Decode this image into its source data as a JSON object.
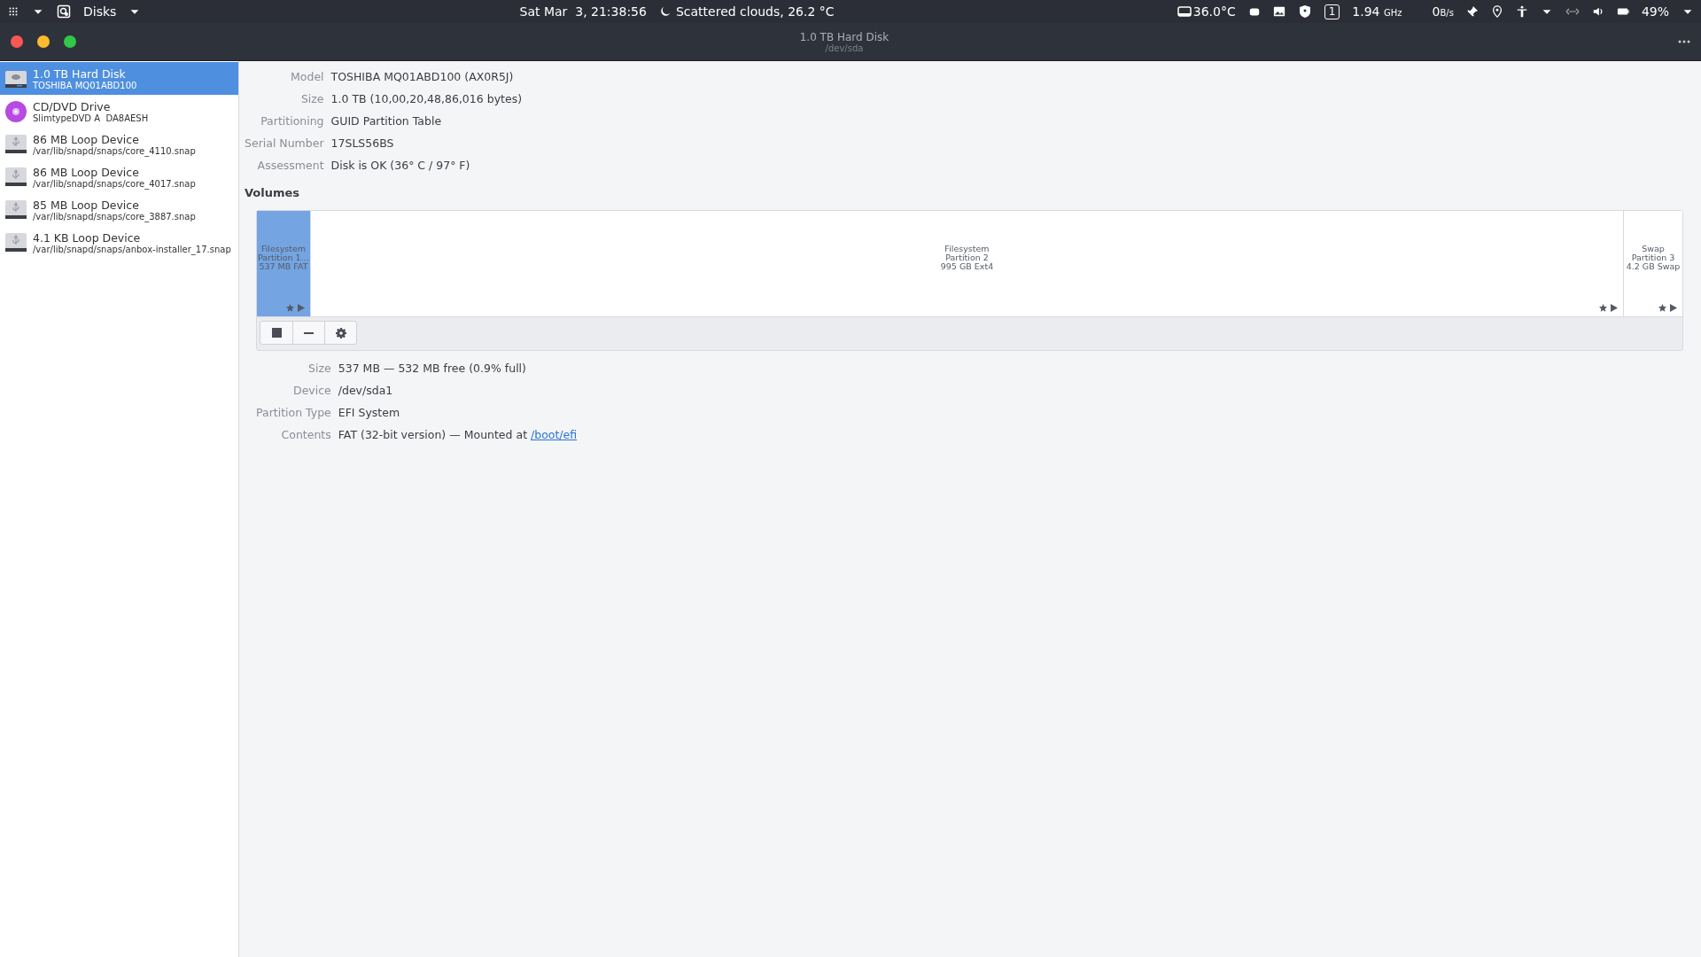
{
  "top_panel": {
    "app_name": "Disks",
    "clock": "Sat Mar  3, 21:38:56",
    "weather": "Scattered clouds, 26.2 °C",
    "disk_temp": "36.0°C",
    "workspace": "1",
    "cpu_freq": "1.94",
    "cpu_unit": "GHz",
    "net_speed": "0",
    "net_unit": "B/s",
    "battery": "49%"
  },
  "window": {
    "title": "1.0 TB Hard Disk",
    "subtitle": "/dev/sda"
  },
  "sidebar": {
    "items": [
      {
        "kind": "hdd",
        "name": "1.0 TB Hard Disk",
        "detail": "TOSHIBA MQ01ABD100",
        "selected": true
      },
      {
        "kind": "optical",
        "name": "CD/DVD Drive",
        "detail": "SlimtypeDVD A  DA8AESH",
        "selected": false
      },
      {
        "kind": "loop",
        "name": "86 MB Loop Device",
        "detail": "/var/lib/snapd/snaps/core_4110.snap",
        "selected": false
      },
      {
        "kind": "loop",
        "name": "86 MB Loop Device",
        "detail": "/var/lib/snapd/snaps/core_4017.snap",
        "selected": false
      },
      {
        "kind": "loop",
        "name": "85 MB Loop Device",
        "detail": "/var/lib/snapd/snaps/core_3887.snap",
        "selected": false
      },
      {
        "kind": "loop",
        "name": "4.1 KB Loop Device",
        "detail": "/var/lib/snapd/snaps/anbox-installer_17.snap",
        "selected": false
      }
    ]
  },
  "disk_info": [
    {
      "label": "Model",
      "value": "TOSHIBA MQ01ABD100 (AX0R5J)"
    },
    {
      "label": "Size",
      "value": "1.0 TB (10,00,20,48,86,016 bytes)"
    },
    {
      "label": "Partitioning",
      "value": "GUID Partition Table"
    },
    {
      "label": "Serial Number",
      "value": "17SLS56BS"
    },
    {
      "label": "Assessment",
      "value": "Disk is OK (36° C / 97° F)"
    }
  ],
  "volumes": {
    "heading": "Volumes",
    "partitions": [
      {
        "lines": [
          "Filesystem",
          "Partition 1…",
          "537 MB FAT"
        ],
        "selected": true
      },
      {
        "lines": [
          "Filesystem",
          "Partition 2",
          "995 GB Ext4"
        ],
        "selected": false
      },
      {
        "lines": [
          "Swap",
          "Partition 3",
          "4.2 GB Swap"
        ],
        "selected": false
      }
    ]
  },
  "volume_info": [
    {
      "label": "Size",
      "value": "537 MB — 532 MB free (0.9% full)"
    },
    {
      "label": "Device",
      "value": "/dev/sda1"
    },
    {
      "label": "Partition Type",
      "value": "EFI System"
    },
    {
      "label": "Contents",
      "value": "FAT (32-bit version) — Mounted at",
      "link": "/boot/efi"
    }
  ]
}
